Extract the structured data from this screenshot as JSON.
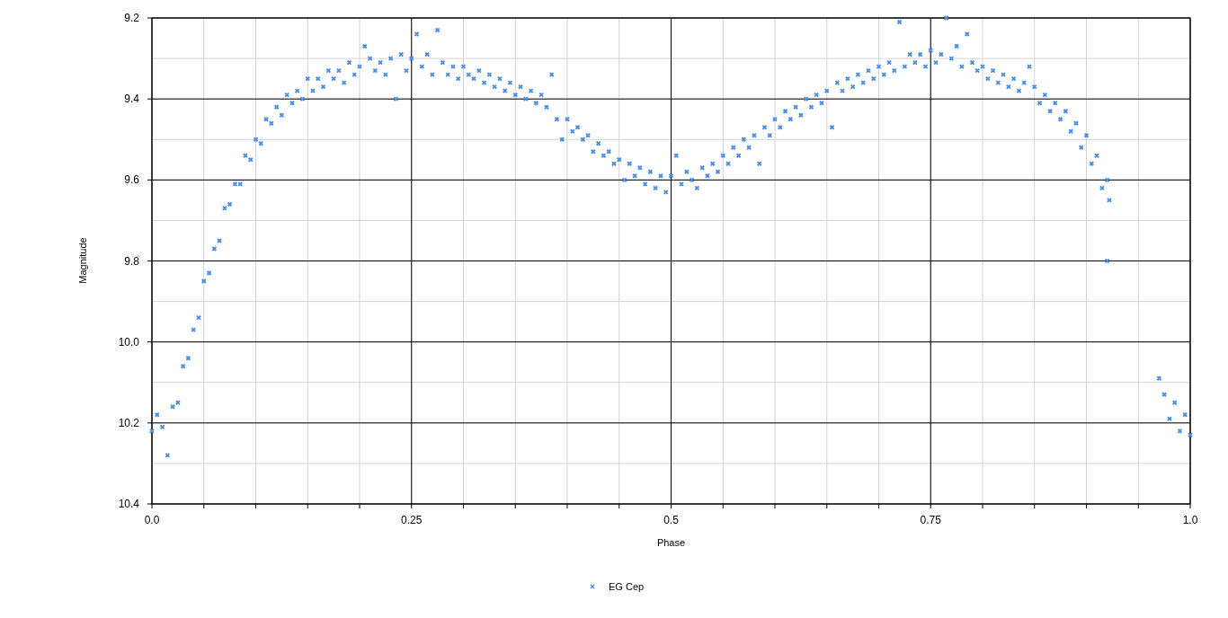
{
  "chart": {
    "chart_data": {
      "type": "scatter",
      "xlabel": "Phase",
      "ylabel": "Magnitude",
      "x": [
        0,
        0.005,
        0.01,
        0.015,
        0.02,
        0.025,
        0.03,
        0.035,
        0.04,
        0.045,
        0.05,
        0.055,
        0.06,
        0.065,
        0.07,
        0.075,
        0.08,
        0.085,
        0.09,
        0.095,
        0.1,
        0.105,
        0.11,
        0.115,
        0.12,
        0.125,
        0.13,
        0.135,
        0.14,
        0.145,
        0.15,
        0.155,
        0.16,
        0.165,
        0.17,
        0.175,
        0.18,
        0.185,
        0.19,
        0.195,
        0.2,
        0.205,
        0.21,
        0.215,
        0.22,
        0.225,
        0.23,
        0.235,
        0.24,
        0.245,
        0.25,
        0.255,
        0.26,
        0.265,
        0.27,
        0.275,
        0.28,
        0.285,
        0.29,
        0.295,
        0.3,
        0.305,
        0.31,
        0.315,
        0.32,
        0.325,
        0.33,
        0.335,
        0.34,
        0.345,
        0.35,
        0.355,
        0.36,
        0.365,
        0.37,
        0.375,
        0.38,
        0.385,
        0.39,
        0.395,
        0.4,
        0.405,
        0.41,
        0.415,
        0.42,
        0.425,
        0.43,
        0.435,
        0.44,
        0.445,
        0.45,
        0.455,
        0.46,
        0.465,
        0.47,
        0.475,
        0.48,
        0.485,
        0.49,
        0.495,
        0.5,
        0.505,
        0.51,
        0.515,
        0.52,
        0.525,
        0.53,
        0.535,
        0.54,
        0.545,
        0.55,
        0.555,
        0.56,
        0.565,
        0.57,
        0.575,
        0.58,
        0.585,
        0.59,
        0.595,
        0.6,
        0.605,
        0.61,
        0.615,
        0.62,
        0.625,
        0.63,
        0.635,
        0.64,
        0.645,
        0.65,
        0.655,
        0.66,
        0.665,
        0.67,
        0.675,
        0.68,
        0.685,
        0.69,
        0.695,
        0.7,
        0.705,
        0.71,
        0.715,
        0.72,
        0.725,
        0.73,
        0.735,
        0.74,
        0.745,
        0.75,
        0.755,
        0.76,
        0.765,
        0.77,
        0.775,
        0.78,
        0.785,
        0.79,
        0.795,
        0.8,
        0.805,
        0.81,
        0.815,
        0.82,
        0.825,
        0.83,
        0.835,
        0.84,
        0.845,
        0.85,
        0.855,
        0.86,
        0.865,
        0.87,
        0.875,
        0.88,
        0.885,
        0.89,
        0.895,
        0.9,
        0.905,
        0.91,
        0.915,
        0.92,
        0.92,
        0.922,
        0.97,
        0.975,
        0.98,
        0.985,
        0.99,
        0.995,
        1
      ],
      "series": [
        {
          "name": "EG Cep",
          "color": "#4a8fe7",
          "values": [
            10.22,
            10.18,
            10.21,
            10.28,
            10.16,
            10.15,
            10.06,
            10.04,
            9.97,
            9.94,
            9.85,
            9.83,
            9.77,
            9.75,
            9.67,
            9.66,
            9.61,
            9.61,
            9.54,
            9.55,
            9.5,
            9.51,
            9.45,
            9.46,
            9.42,
            9.44,
            9.39,
            9.41,
            9.38,
            9.4,
            9.35,
            9.38,
            9.35,
            9.37,
            9.33,
            9.35,
            9.33,
            9.36,
            9.31,
            9.34,
            9.32,
            9.27,
            9.3,
            9.33,
            9.31,
            9.34,
            9.3,
            9.4,
            9.29,
            9.33,
            9.3,
            9.24,
            9.32,
            9.29,
            9.34,
            9.23,
            9.31,
            9.34,
            9.32,
            9.35,
            9.32,
            9.34,
            9.35,
            9.33,
            9.36,
            9.34,
            9.37,
            9.35,
            9.38,
            9.36,
            9.39,
            9.37,
            9.4,
            9.38,
            9.41,
            9.39,
            9.42,
            9.34,
            9.45,
            9.5,
            9.45,
            9.48,
            9.47,
            9.5,
            9.49,
            9.53,
            9.51,
            9.54,
            9.53,
            9.56,
            9.55,
            9.6,
            9.56,
            9.59,
            9.57,
            9.61,
            9.58,
            9.62,
            9.59,
            9.63,
            9.59,
            9.54,
            9.61,
            9.58,
            9.6,
            9.62,
            9.57,
            9.59,
            9.56,
            9.58,
            9.54,
            9.56,
            9.52,
            9.54,
            9.5,
            9.52,
            9.49,
            9.56,
            9.47,
            9.49,
            9.45,
            9.47,
            9.43,
            9.45,
            9.42,
            9.44,
            9.4,
            9.42,
            9.39,
            9.41,
            9.38,
            9.47,
            9.36,
            9.38,
            9.35,
            9.37,
            9.34,
            9.36,
            9.33,
            9.35,
            9.32,
            9.34,
            9.31,
            9.33,
            9.21,
            9.32,
            9.29,
            9.31,
            9.29,
            9.32,
            9.28,
            9.31,
            9.29,
            9.2,
            9.3,
            9.27,
            9.32,
            9.24,
            9.31,
            9.33,
            9.32,
            9.35,
            9.33,
            9.36,
            9.34,
            9.37,
            9.35,
            9.38,
            9.36,
            9.32,
            9.37,
            9.41,
            9.39,
            9.43,
            9.41,
            9.45,
            9.43,
            9.48,
            9.46,
            9.52,
            9.49,
            9.56,
            9.54,
            9.62,
            9.6,
            9.8,
            9.65,
            10.09,
            10.13,
            10.19,
            10.15,
            10.22,
            10.18,
            10.23
          ]
        }
      ],
      "grid": true,
      "xlim": [
        0,
        1
      ],
      "ylim": [
        10.4,
        9.2
      ],
      "xticks": [
        {
          "value": 0,
          "label": "0.0"
        },
        {
          "value": 0.25,
          "label": "0.25"
        },
        {
          "value": 0.5,
          "label": "0.5"
        },
        {
          "value": 0.75,
          "label": "0.75"
        },
        {
          "value": 1,
          "label": "1.0"
        }
      ],
      "yticks": [
        {
          "value": 9.2,
          "label": "9.2"
        },
        {
          "value": 9.4,
          "label": "9.4"
        },
        {
          "value": 9.6,
          "label": "9.6"
        },
        {
          "value": 9.8,
          "label": "9.8"
        },
        {
          "value": 10,
          "label": "10.0"
        },
        {
          "value": 10.2,
          "label": "10.2"
        },
        {
          "value": 10.4,
          "label": "10.4"
        }
      ]
    }
  }
}
